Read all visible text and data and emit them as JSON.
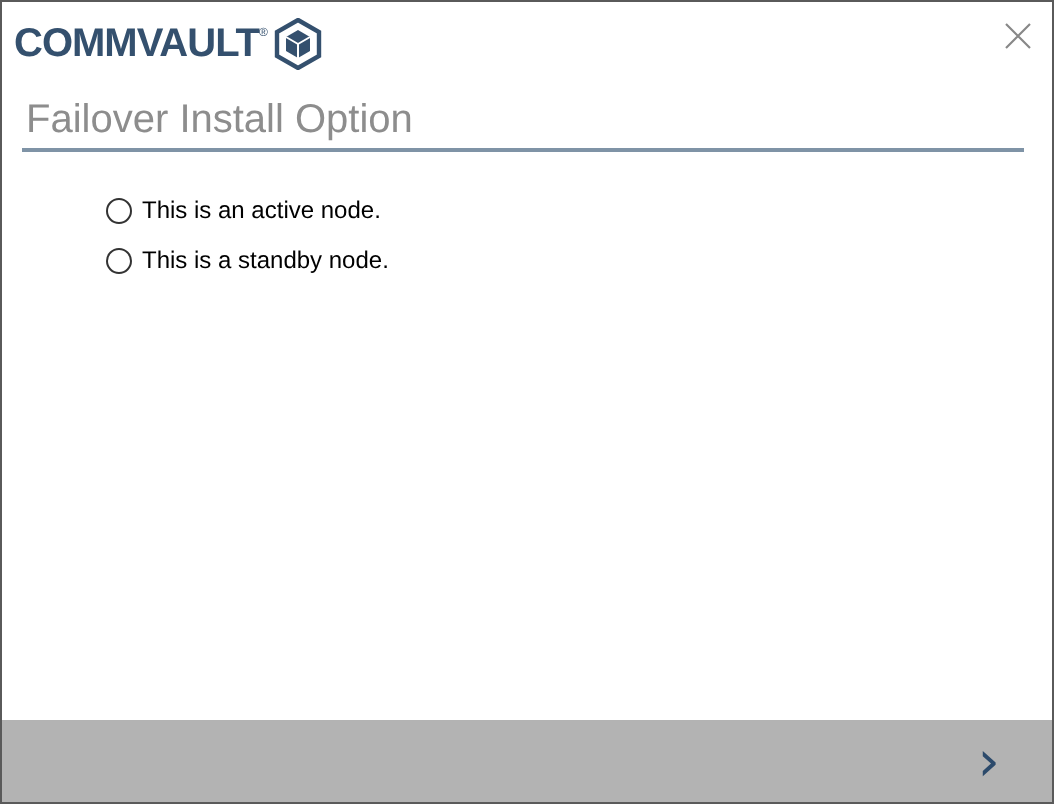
{
  "logo": {
    "text": "COMMVAULT$^{®}$"
  },
  "heading": "Failover Install Option",
  "options": [
    {
      "label": "This is an active node.",
      "selected": false
    },
    {
      "label": "This is a standby node.",
      "selected": false
    }
  ],
  "footer": {
    "next": "›"
  }
}
